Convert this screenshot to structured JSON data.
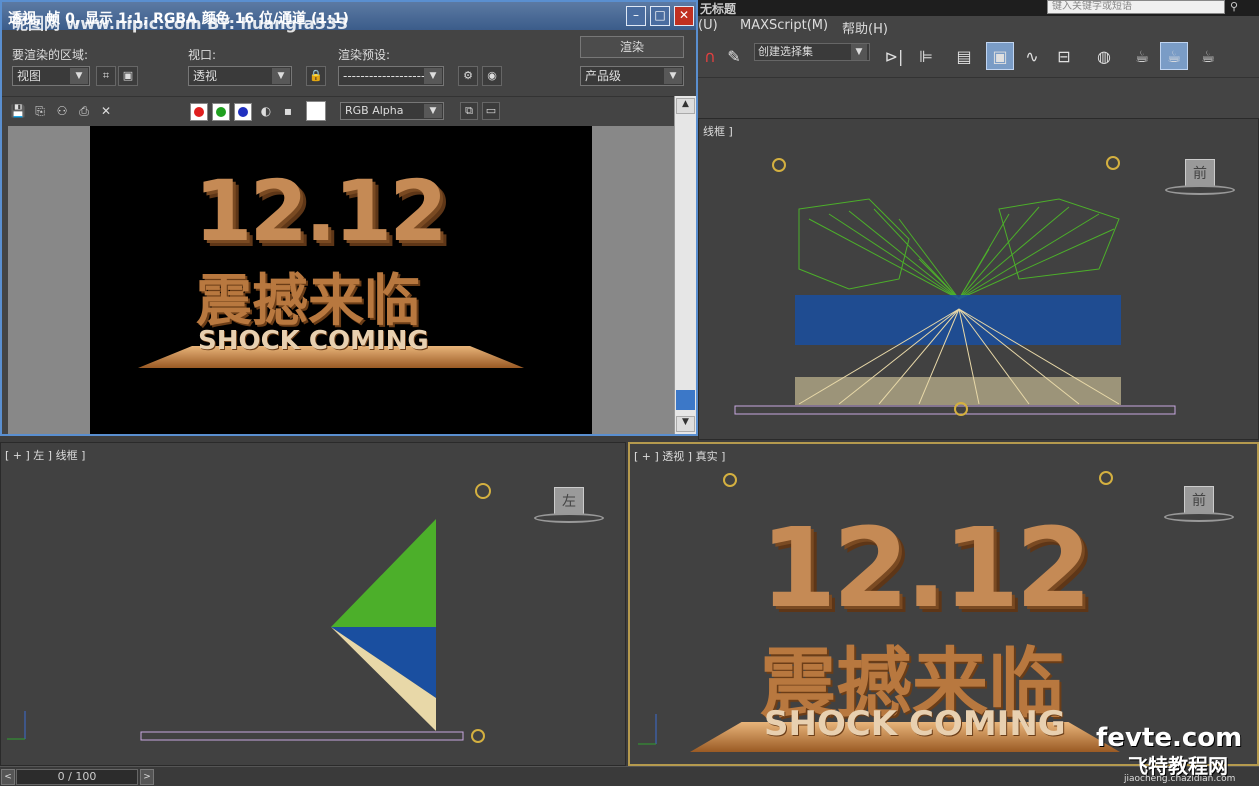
{
  "app": {
    "title": "无标题",
    "search_placeholder": "键入关键字或短语"
  },
  "menubar": {
    "items": [
      "(U)",
      "MAXScript(M)",
      "帮助(H)"
    ]
  },
  "toolbar": {
    "selection_set": "创建选择集"
  },
  "dialog": {
    "title": "透视, 帧 0, 显示 1:1, RGBA 颜色 16 位/通道 (1:1)",
    "watermark": "昵图网 www.nipic.com      BY: huangfa533",
    "area_label": "要渲染的区域:",
    "area_value": "视图",
    "viewport_label": "视口:",
    "viewport_value": "透视",
    "preset_label": "渲染预设:",
    "preset_value": "-------------------",
    "render_button": "渲染",
    "quality_value": "产品级",
    "channel_value": "RGB Alpha"
  },
  "render_image": {
    "number": "12.12",
    "chinese": "震撼来临",
    "english": "SHOCK COMING"
  },
  "viewports": {
    "top_right_label": "线框 ]",
    "bottom_left_label": "[ + ] 左 ] 线框 ]",
    "bottom_right_label": "[ + ] 透视 ] 真实 ]",
    "front_cube": "前",
    "left_cube": "左"
  },
  "timeline": {
    "position": "0 / 100",
    "prev": "<",
    "next": ">"
  },
  "watermark": {
    "line1": "fevte.com",
    "line2": "飞特教程网",
    "line3": "jiaocheng.chazidian.com"
  },
  "colors": {
    "accent": "#5a8fd0",
    "active_viewport": "#b59a4e",
    "green_wire": "#4caf2a",
    "blue_wire": "#1a4fa0",
    "cream_wire": "#e8d8a8",
    "gold": "#c58a55"
  }
}
